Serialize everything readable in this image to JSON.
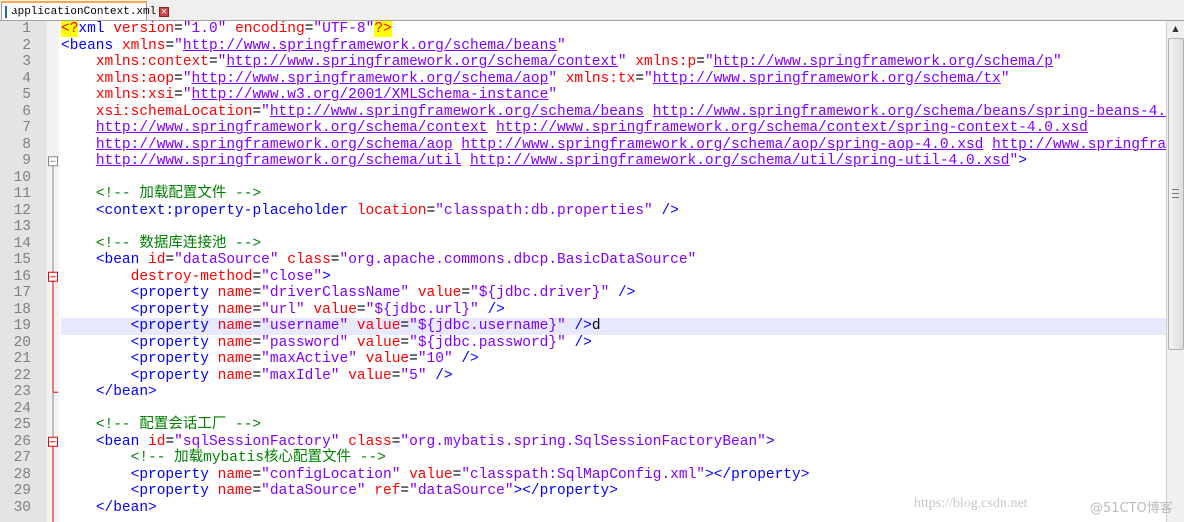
{
  "tab": {
    "filename": "applicationContext.xml",
    "icon": "save-icon",
    "close": "×"
  },
  "current_line": 19,
  "colors": {
    "tag": "#0000ff",
    "attribute": "#ff0000",
    "value": "#8000ff",
    "comment": "#008000",
    "current_line": "#e8e8ff",
    "pi_highlight": "#ffff00"
  },
  "lines": [
    "<?xml version=\"1.0\" encoding=\"UTF-8\"?>",
    "<beans xmlns=\"http://www.springframework.org/schema/beans\"",
    "    xmlns:context=\"http://www.springframework.org/schema/context\" xmlns:p=\"http://www.springframework.org/schema/p\"",
    "    xmlns:aop=\"http://www.springframework.org/schema/aop\" xmlns:tx=\"http://www.springframework.org/schema/tx\"",
    "    xmlns:xsi=\"http://www.w3.org/2001/XMLSchema-instance\"",
    "    xsi:schemaLocation=\"http://www.springframework.org/schema/beans http://www.springframework.org/schema/beans/spring-beans-4.",
    "    http://www.springframework.org/schema/context http://www.springframework.org/schema/context/spring-context-4.0.xsd",
    "    http://www.springframework.org/schema/aop http://www.springframework.org/schema/aop/spring-aop-4.0.xsd http://www.springfra",
    "    http://www.springframework.org/schema/util http://www.springframework.org/schema/util/spring-util-4.0.xsd\">",
    "",
    "    <!-- 加载配置文件 -->",
    "    <context:property-placeholder location=\"classpath:db.properties\" />",
    "",
    "    <!-- 数据库连接池 -->",
    "    <bean id=\"dataSource\" class=\"org.apache.commons.dbcp.BasicDataSource\"",
    "        destroy-method=\"close\">",
    "        <property name=\"driverClassName\" value=\"${jdbc.driver}\" />",
    "        <property name=\"url\" value=\"${jdbc.url}\" />",
    "        <property name=\"username\" value=\"${jdbc.username}\" />d",
    "        <property name=\"password\" value=\"${jdbc.password}\" />",
    "        <property name=\"maxActive\" value=\"10\" />",
    "        <property name=\"maxIdle\" value=\"5\" />",
    "    </bean>",
    "",
    "    <!-- 配置会话工厂 -->",
    "    <bean id=\"sqlSessionFactory\" class=\"org.mybatis.spring.SqlSessionFactoryBean\">",
    "        <!-- 加载mybatis核心配置文件 -->",
    "        <property name=\"configLocation\" value=\"classpath:SqlMapConfig.xml\"></property>",
    "        <property name=\"dataSource\" ref=\"dataSource\"></property>",
    "    </bean>"
  ],
  "watermark": {
    "text": "https://blog.csdn.net",
    "overlay": "@51CTO博客"
  }
}
